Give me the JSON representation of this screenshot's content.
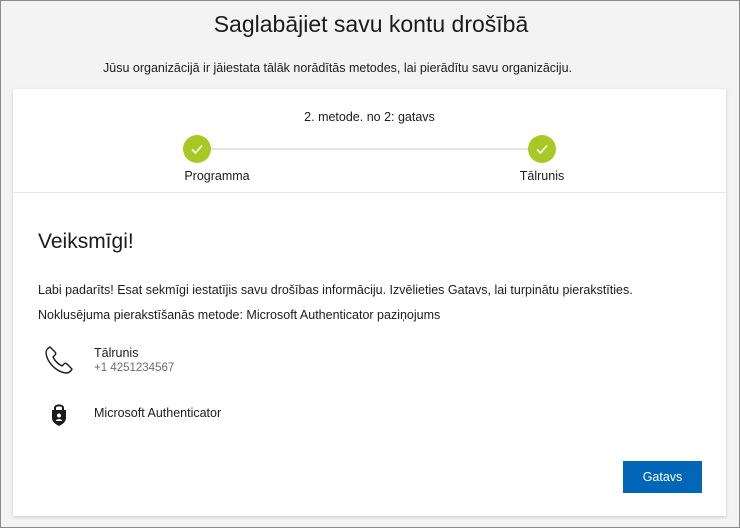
{
  "header": {
    "title": "Saglabājiet savu kontu drošībā",
    "subtitle": "Jūsu organizācijā ir jāiestata tālāk norādītās metodes, lai pierādītu savu organizāciju."
  },
  "progress": {
    "step_counter": "2. metode. no 2: gatavs",
    "steps": [
      {
        "label": "Programma",
        "status": "complete",
        "icon": "checkmark-icon"
      },
      {
        "label": "Tālrunis",
        "status": "complete",
        "icon": "checkmark-icon"
      }
    ],
    "accent_color": "#a8c825"
  },
  "content": {
    "title": "Veiksmīgi!",
    "message": "Labi padarīts! Esat sekmīgi iestatījis savu drošības informāciju. Izvēlieties Gatavs, lai turpinātu pierakstīties.",
    "default_method": "Noklusējuma pierakstīšanās metode: Microsoft Authenticator paziņojums",
    "methods": [
      {
        "icon": "phone-icon",
        "name": "Tālrunis",
        "detail": "+1 4251234567"
      },
      {
        "icon": "authenticator-lock-icon",
        "name": "Microsoft Authenticator"
      }
    ]
  },
  "actions": {
    "done_label": "Gatavs",
    "button_color": "#0067b8"
  }
}
